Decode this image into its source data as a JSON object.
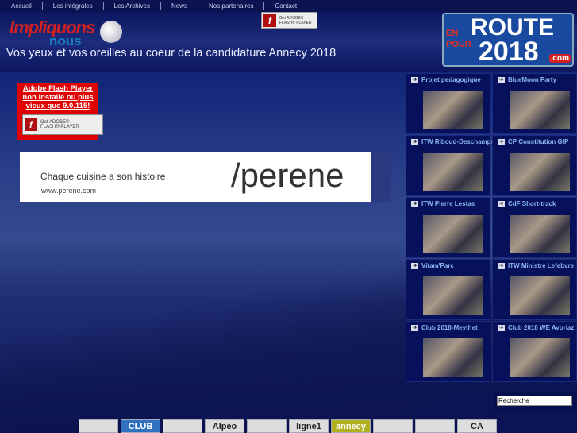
{
  "nav": [
    "Accueil",
    "Les intégrales",
    "Les Archives",
    "News",
    "Nos partenaires",
    "Contact"
  ],
  "header": {
    "logo_line1": "Impliquons",
    "logo_line2": "nous",
    "tagline": "Vos yeux et vos oreilles au coeur de la candidature Annecy 2018",
    "route_en": "EN",
    "route_pour": "POUR",
    "route_1": "ROUTE",
    "route_2": "2018",
    "route_com": ".com"
  },
  "flash": {
    "get": "Get ADOBE®",
    "player": "FLASH® PLAYER",
    "notice": "Adobe Flash Player non installé ou plus vieux que 9.0.115!"
  },
  "ad": {
    "tagline": "Chaque cuisine a son histoire",
    "url": "www.perene.com",
    "brand": "/perene"
  },
  "tiles_left": [
    "Projet pedagogique",
    "ITW Riboud-Deschamps",
    "ITW Pierre Lestas",
    "Vitam'Parc",
    "Club 2018-Meythet"
  ],
  "tiles_right": [
    "BlueMoon Party",
    "CP Constitution GIP",
    "CdF Short-track",
    "ITW Ministre Lefebvre",
    "Club 2018 WE Avoriaz"
  ],
  "search": {
    "value": "Recherche"
  },
  "partners": [
    "",
    "CLUB",
    "",
    "Alpéo",
    "",
    "ligne1",
    "annecy",
    "",
    "",
    "CA"
  ]
}
